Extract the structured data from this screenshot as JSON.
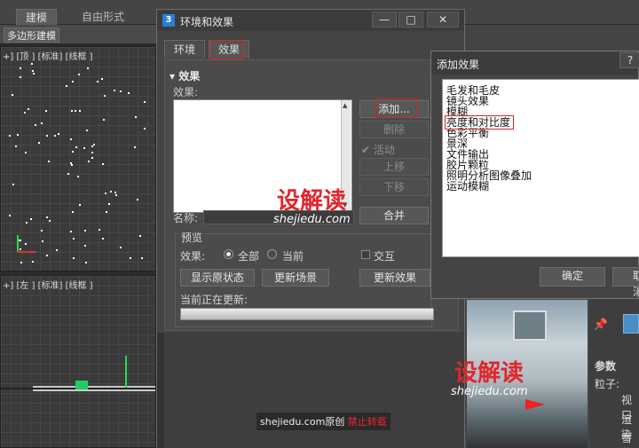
{
  "app": {
    "tabs": [
      "建模",
      "自由形式"
    ],
    "ribbon_button": "多边形建模",
    "viewports": [
      {
        "label": "+] [顶 ] [标准] [线框 ]"
      },
      {
        "label": "+] [左 ] [标准] [线框 ]"
      }
    ],
    "command_panel": {
      "section": "参数",
      "rows": [
        "粒子:",
        "视口",
        "渲染",
        "雪花"
      ]
    },
    "icons": [
      "pin-icon"
    ]
  },
  "env_dialog": {
    "app_icon": "3",
    "title": "环境和效果",
    "window_buttons": {
      "minimize": "—",
      "maximize": "□",
      "close": "✕"
    },
    "tabs": [
      "环境",
      "效果"
    ],
    "section_title": "效果",
    "effects_label": "效果:",
    "buttons": {
      "add": "添加...",
      "delete": "删除",
      "active": "活动",
      "up": "上移",
      "down": "下移",
      "merge": "合并"
    },
    "name_label": "名称:",
    "name_value": "",
    "preview": {
      "title": "预览",
      "effect_label": "效果:",
      "radio_all": "全部",
      "radio_current": "当前",
      "interactive": "交互",
      "show_original": "显示原状态",
      "update_scene": "更新场景",
      "update_effect": "更新效果",
      "currently_updating": "当前正在更新:",
      "progress": 1.0
    }
  },
  "add_effect_dialog": {
    "title": "添加效果",
    "help": "?",
    "items": [
      "毛发和毛皮",
      "镜头效果",
      "模糊",
      "亮度和对比度",
      "色彩平衡",
      "景深",
      "文件输出",
      "胶片颗粒",
      "照明分析图像叠加",
      "运动模糊"
    ],
    "highlighted_item": "亮度和对比度",
    "ok": "确定",
    "cancel": "取消"
  },
  "watermark": {
    "logo_text": "设解读",
    "domain": "shejiedu.com",
    "banner_prefix": "shejiedu.com原创",
    "banner_warning": "禁止转载"
  },
  "colors": {
    "highlight_box": "#dd2222",
    "wm_red": "#e0262e"
  }
}
